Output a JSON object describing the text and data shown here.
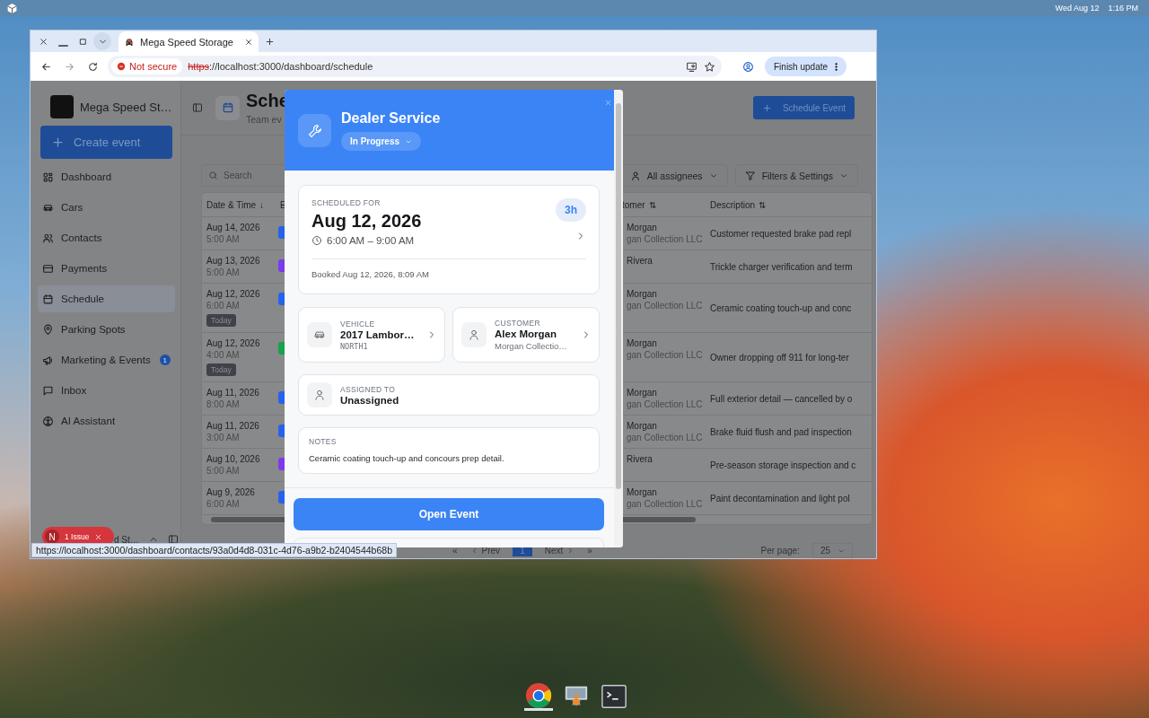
{
  "top_bar": {
    "date": "Wed Aug 12",
    "time": "1:16 PM"
  },
  "browser": {
    "tab_title": "Mega Speed Storage",
    "security_label": "Not secure",
    "url_scheme": "https",
    "url_rest": "://localhost:3000/dashboard/schedule",
    "update_button": "Finish update",
    "status_url": "https://localhost:3000/dashboard/contacts/93a0d4d8-031c-4d76-a9b2-b2404544b68b"
  },
  "sidebar": {
    "brand": "Mega Speed St…",
    "create_button": "Create event",
    "items": [
      {
        "kind": "dashboard",
        "label": "Dashboard",
        "selected": false
      },
      {
        "kind": "cars",
        "label": "Cars",
        "selected": false
      },
      {
        "kind": "contacts",
        "label": "Contacts",
        "selected": false
      },
      {
        "kind": "payments",
        "label": "Payments",
        "selected": false
      },
      {
        "kind": "schedule",
        "label": "Schedule",
        "selected": true
      },
      {
        "kind": "parking",
        "label": "Parking Spots",
        "selected": false
      },
      {
        "kind": "marketing",
        "label": "Marketing & Events",
        "selected": false,
        "badge": "1"
      },
      {
        "kind": "inbox",
        "label": "Inbox",
        "selected": false
      },
      {
        "kind": "assistant",
        "label": "AI Assistant",
        "selected": false
      }
    ],
    "footer_text": "d St…",
    "issue_badge": {
      "letter": "N",
      "label": "1 Issue"
    }
  },
  "header": {
    "title": "Sche",
    "subtitle": "Team ev",
    "action_button": "Schedule Event"
  },
  "toolbar": {
    "search": {
      "placeholder": "Search"
    },
    "assignee_filter": "All assignees",
    "filter_button": "Filters & Settings"
  },
  "table": {
    "columns": [
      {
        "label": "Date & Time",
        "sort": "↓"
      },
      {
        "label": "E"
      },
      {
        "label": "tomer",
        "sort": "⇅"
      },
      {
        "label": "Description",
        "sort": "⇅"
      }
    ],
    "rows": [
      {
        "date": "Aug 14, 2026",
        "time": "5:00 AM",
        "color": "#2563eb",
        "customer": "Morgan",
        "company": "gan Collection LLC",
        "description": "Customer requested brake pad repl"
      },
      {
        "date": "Aug 13, 2026",
        "time": "5:00 AM",
        "color": "#7c3aed",
        "customer": "Rivera",
        "description": "Trickle charger verification and term"
      },
      {
        "date": "Aug 12, 2026",
        "time": "6:00 AM",
        "badge": "Today",
        "color": "#2563eb",
        "customer": "Morgan",
        "company": "gan Collection LLC",
        "description": "Ceramic coating touch-up and conc"
      },
      {
        "date": "Aug 12, 2026",
        "time": "4:00 AM",
        "badge": "Today",
        "color": "#16a34a",
        "customer": "Morgan",
        "company": "gan Collection LLC",
        "description": "Owner dropping off 911 for long-ter"
      },
      {
        "date": "Aug 11, 2026",
        "time": "8:00 AM",
        "color": "#2563eb",
        "customer": "Morgan",
        "company": "gan Collection LLC",
        "description": "Full exterior detail — cancelled by o"
      },
      {
        "date": "Aug 11, 2026",
        "time": "3:00 AM",
        "color": "#2563eb",
        "customer": "Morgan",
        "company": "gan Collection LLC",
        "description": "Brake fluid flush and pad inspection"
      },
      {
        "date": "Aug 10, 2026",
        "time": "5:00 AM",
        "color": "#7c3aed",
        "customer": "Rivera",
        "description": "Pre-season storage inspection and c"
      },
      {
        "date": "Aug 9, 2026",
        "time": "6:00 AM",
        "color": "#2563eb",
        "customer": "Morgan",
        "company": "gan Collection LLC",
        "description": "Paint decontamination and light pol"
      }
    ]
  },
  "pagination": {
    "first": "«",
    "prev": "Prev",
    "current_page": "1",
    "next": "Next",
    "last": "»",
    "per_page_label": "Per page:",
    "per_page": "25"
  },
  "modal": {
    "title": "Dealer Service",
    "status": "In Progress",
    "schedule": {
      "label": "SCHEDULED FOR",
      "date": "Aug 12, 2026",
      "time_range": "6:00 AM – 9:00 AM",
      "duration": "3h",
      "booked": "Booked Aug 12, 2026, 8:09 AM"
    },
    "links": [
      {
        "kind": "vehicle",
        "label": "VEHICLE",
        "title": "2017 Lambor…",
        "detail": "NORTH1"
      },
      {
        "kind": "customer",
        "label": "CUSTOMER",
        "title": "Alex Morgan",
        "detail": "Morgan Collectio…"
      }
    ],
    "assigned": {
      "label": "ASSIGNED TO",
      "value": "Unassigned"
    },
    "notes": {
      "label": "NOTES",
      "text": "Ceramic coating touch-up and concours prep detail."
    },
    "primary_button": "Open Event"
  },
  "dock": [
    {
      "kind": "browser",
      "selected": true
    },
    {
      "kind": "monitor",
      "selected": false
    },
    {
      "kind": "terminal",
      "selected": false
    }
  ]
}
